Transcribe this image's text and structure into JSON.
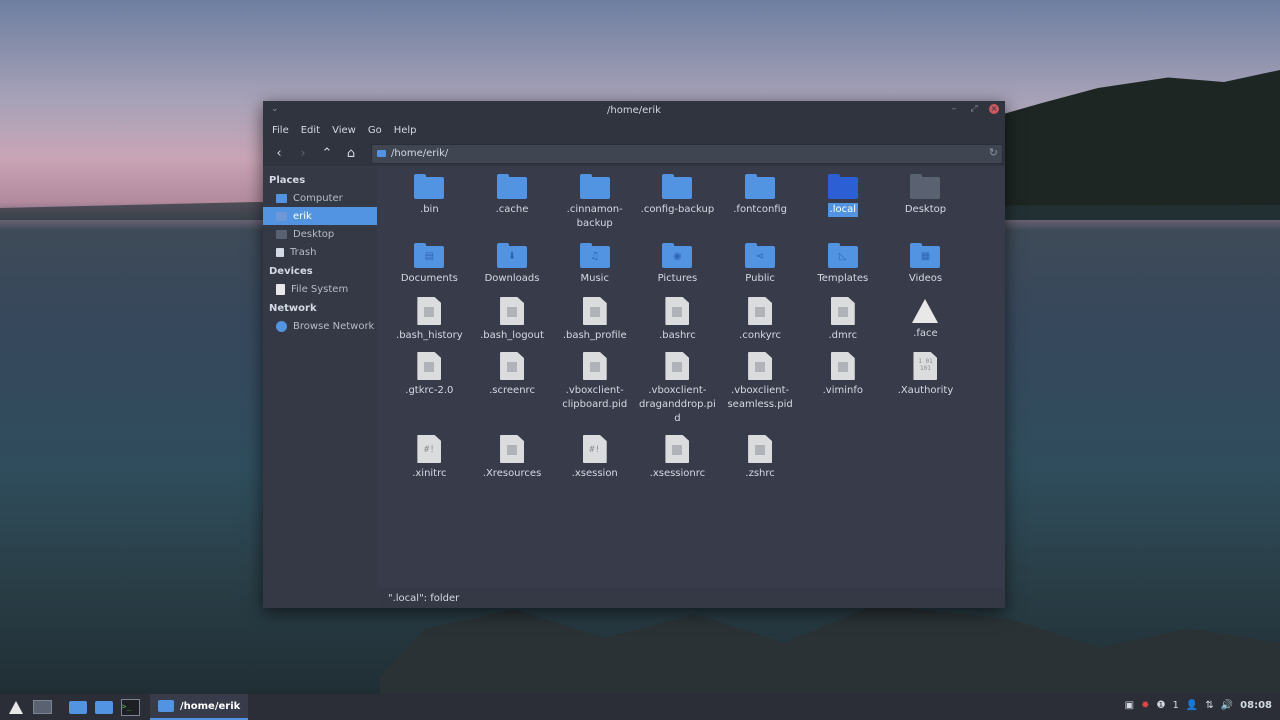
{
  "window": {
    "title": "/home/erik",
    "menu": [
      "File",
      "Edit",
      "View",
      "Go",
      "Help"
    ],
    "path": "/home/erik/",
    "status": "\".local\": folder"
  },
  "sidebar": {
    "sections": [
      {
        "title": "Places",
        "items": [
          {
            "label": "Computer",
            "icon": "computer-icon"
          },
          {
            "label": "erik",
            "icon": "home-icon",
            "selected": true
          },
          {
            "label": "Desktop",
            "icon": "desktop-icon"
          },
          {
            "label": "Trash",
            "icon": "trash-icon"
          }
        ]
      },
      {
        "title": "Devices",
        "items": [
          {
            "label": "File System",
            "icon": "drive-icon"
          }
        ]
      },
      {
        "title": "Network",
        "items": [
          {
            "label": "Browse Network",
            "icon": "network-icon"
          }
        ]
      }
    ]
  },
  "files": [
    {
      "name": ".bin",
      "type": "folder"
    },
    {
      "name": ".cache",
      "type": "folder"
    },
    {
      "name": ".cinnamon-backup",
      "type": "folder"
    },
    {
      "name": ".config-backup",
      "type": "folder"
    },
    {
      "name": ".fontconfig",
      "type": "folder"
    },
    {
      "name": ".local",
      "type": "folder",
      "selected": true
    },
    {
      "name": "Desktop",
      "type": "folder-dark"
    },
    {
      "name": "Documents",
      "type": "folder",
      "glyph": "▤"
    },
    {
      "name": "Downloads",
      "type": "folder",
      "glyph": "⬇"
    },
    {
      "name": "Music",
      "type": "folder",
      "glyph": "♫"
    },
    {
      "name": "Pictures",
      "type": "folder",
      "glyph": "◉"
    },
    {
      "name": "Public",
      "type": "folder",
      "glyph": "⋖"
    },
    {
      "name": "Templates",
      "type": "folder",
      "glyph": "◺"
    },
    {
      "name": "Videos",
      "type": "folder",
      "glyph": "▦"
    },
    {
      "name": ".bash_history",
      "type": "file"
    },
    {
      "name": ".bash_logout",
      "type": "file"
    },
    {
      "name": ".bash_profile",
      "type": "file"
    },
    {
      "name": ".bashrc",
      "type": "file"
    },
    {
      "name": ".conkyrc",
      "type": "file"
    },
    {
      "name": ".dmrc",
      "type": "file"
    },
    {
      "name": ".face",
      "type": "arch"
    },
    {
      "name": ".gtkrc-2.0",
      "type": "file"
    },
    {
      "name": ".screenrc",
      "type": "file"
    },
    {
      "name": ".vboxclient-clipboard.pid",
      "type": "file"
    },
    {
      "name": ".vboxclient-draganddrop.pid",
      "type": "file"
    },
    {
      "name": ".vboxclient-seamless.pid",
      "type": "file"
    },
    {
      "name": ".viminfo",
      "type": "file"
    },
    {
      "name": ".Xauthority",
      "type": "file",
      "tag": "1 01 101"
    },
    {
      "name": ".xinitrc",
      "type": "file",
      "tag": "#!"
    },
    {
      "name": ".Xresources",
      "type": "file"
    },
    {
      "name": ".xsession",
      "type": "file",
      "tag": "#!"
    },
    {
      "name": ".xsessionrc",
      "type": "file"
    },
    {
      "name": ".zshrc",
      "type": "file"
    }
  ],
  "taskbar": {
    "window_title": "/home/erik",
    "clock": "08:08",
    "notification_count": "1"
  }
}
